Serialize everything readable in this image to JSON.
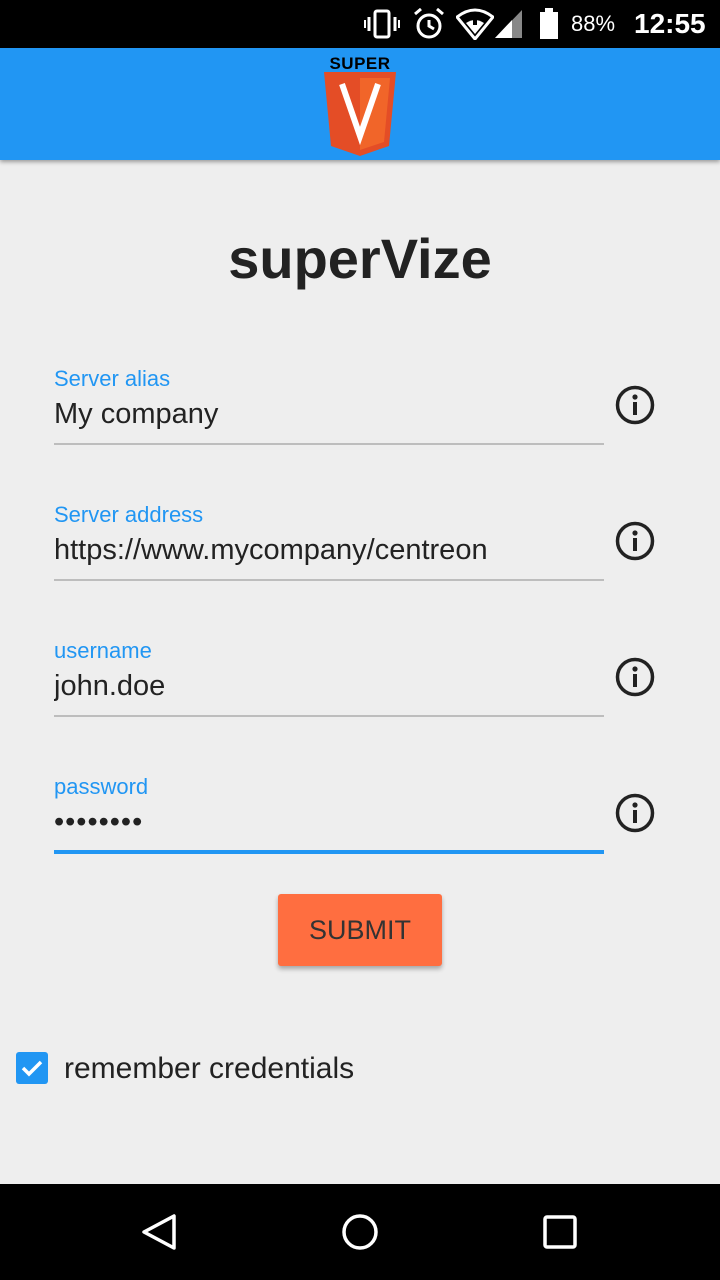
{
  "status_bar": {
    "icons": [
      "vibrate-icon",
      "alarm-icon",
      "wifi-icon",
      "signal-icon",
      "battery-icon"
    ],
    "battery_percent": "88%",
    "time": "12:55"
  },
  "app_bar": {
    "logo_text": "SUPER",
    "logo_letter": "V",
    "colors": {
      "bar": "#2196f3",
      "logo_orange": "#e44d26",
      "logo_light": "#f16529"
    }
  },
  "login": {
    "title": "superVize",
    "fields": [
      {
        "label": "Server alias",
        "value": "My company",
        "type": "text"
      },
      {
        "label": "Server address",
        "value": "https://www.mycompany/centreon",
        "type": "text"
      },
      {
        "label": "username",
        "value": "john.doe",
        "type": "text"
      },
      {
        "label": "password",
        "value": "••••••••",
        "type": "password"
      }
    ],
    "submit_label": "SUBMIT",
    "remember_label": "remember credentials",
    "remember_checked": true,
    "colors": {
      "accent": "#2196f3",
      "submit": "#ff6e40"
    }
  },
  "nav_bar": {
    "icons": [
      "back-icon",
      "home-icon",
      "recents-icon"
    ]
  }
}
